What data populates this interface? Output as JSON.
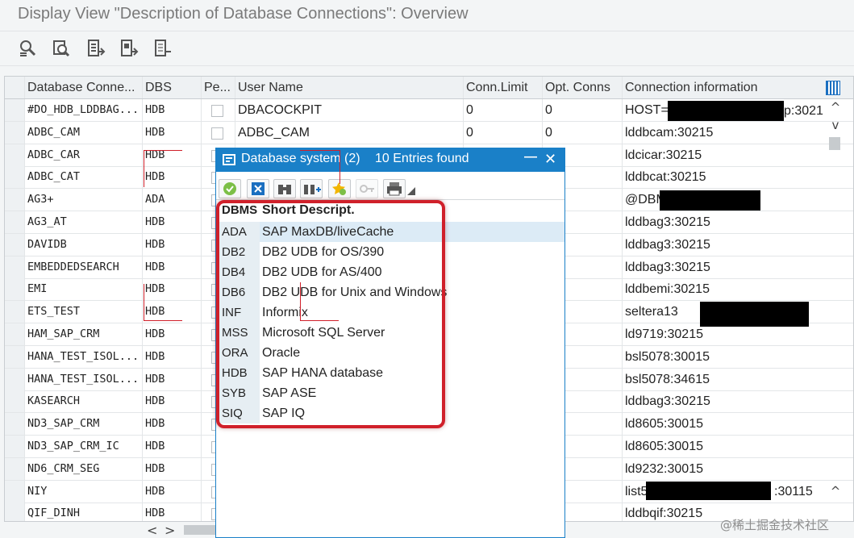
{
  "window": {
    "title": "Display View \"Description of Database Connections\": Overview"
  },
  "toolbar": {
    "icons": [
      "display-icon",
      "find-icon",
      "select-all-icon",
      "select-block-icon",
      "deselect-all-icon"
    ]
  },
  "grid": {
    "headers": {
      "name": "Database Conne...",
      "dbs": "DBS",
      "pe": "Pe...",
      "user": "User Name",
      "limit": "Conn.Limit",
      "opt": "Opt. Conns",
      "info": "Connection information"
    },
    "rows": [
      {
        "name": "#DO_HDB_LDDBAG...",
        "dbs": "HDB",
        "user": "DBACOCKPIT",
        "limit": "0",
        "opt": "0",
        "info": "HOST=",
        "info_tail": "p:3021"
      },
      {
        "name": "ADBC_CAM",
        "dbs": "HDB",
        "user": "ADBC_CAM",
        "limit": "0",
        "opt": "0",
        "info": "lddbcam:30215"
      },
      {
        "name": "ADBC_CAR",
        "dbs": "HDB",
        "info": "ldcicar:30215"
      },
      {
        "name": "ADBC_CAT",
        "dbs": "HDB",
        "info": "lddbcat:30215"
      },
      {
        "name": "AG3+",
        "dbs": "ADA",
        "info": "@DBM"
      },
      {
        "name": "AG3_AT",
        "dbs": "HDB",
        "info": "lddbag3:30215"
      },
      {
        "name": "DAVIDB",
        "dbs": "HDB",
        "info": "lddbag3:30215"
      },
      {
        "name": "EMBEDDEDSEARCH",
        "dbs": "HDB",
        "info": "lddbag3:30215"
      },
      {
        "name": "EMI",
        "dbs": "HDB",
        "info": "lddbemi:30215"
      },
      {
        "name": "ETS_TEST",
        "dbs": "HDB",
        "info": "seltera13"
      },
      {
        "name": "HAM_SAP_CRM",
        "dbs": "HDB",
        "info": "ld9719:30215"
      },
      {
        "name": "HANA_TEST_ISOL...",
        "dbs": "HDB",
        "info": "bsl5078:30015"
      },
      {
        "name": "HANA_TEST_ISOL...",
        "dbs": "HDB",
        "info": "bsl5078:34615"
      },
      {
        "name": "KASEARCH",
        "dbs": "HDB",
        "info": "lddbag3:30215"
      },
      {
        "name": "ND3_SAP_CRM",
        "dbs": "HDB",
        "info": "ld8605:30015"
      },
      {
        "name": "ND3_SAP_CRM_IC",
        "dbs": "HDB",
        "info": "ld8605:30015"
      },
      {
        "name": "ND6_CRM_SEG",
        "dbs": "HDB",
        "info": "ld9232:30015"
      },
      {
        "name": "NIY",
        "dbs": "HDB",
        "info": "list5",
        "info_tail": ":30115"
      },
      {
        "name": "QIF_DINH",
        "dbs": "HDB",
        "info": "lddbqif:30215"
      }
    ]
  },
  "popup": {
    "title": "Database system (2)",
    "count": "10 Entries found",
    "minimize": "—",
    "close": "✕",
    "col_code": "DBMS",
    "col_desc": "Short Descript.",
    "entries": [
      {
        "code": "ADA",
        "desc": "SAP MaxDB/liveCache"
      },
      {
        "code": "DB2",
        "desc": "DB2 UDB for OS/390"
      },
      {
        "code": "DB4",
        "desc": "DB2 UDB for AS/400"
      },
      {
        "code": "DB6",
        "desc": "DB2 UDB for Unix and Windows"
      },
      {
        "code": "INF",
        "desc": "Informix"
      },
      {
        "code": "MSS",
        "desc": "Microsoft SQL Server"
      },
      {
        "code": "ORA",
        "desc": "Oracle"
      },
      {
        "code": "HDB",
        "desc": "SAP HANA database"
      },
      {
        "code": "SYB",
        "desc": "SAP ASE"
      },
      {
        "code": "SIQ",
        "desc": "SAP IQ"
      }
    ]
  },
  "scroll": {
    "up": "^",
    "down": "v",
    "left": "<",
    "right": ">"
  },
  "watermark": "@稀土掘金技术社区",
  "colors": {
    "accent": "#1a80c8",
    "highlight": "#d0202a",
    "selected_row": "#dcebf6"
  }
}
